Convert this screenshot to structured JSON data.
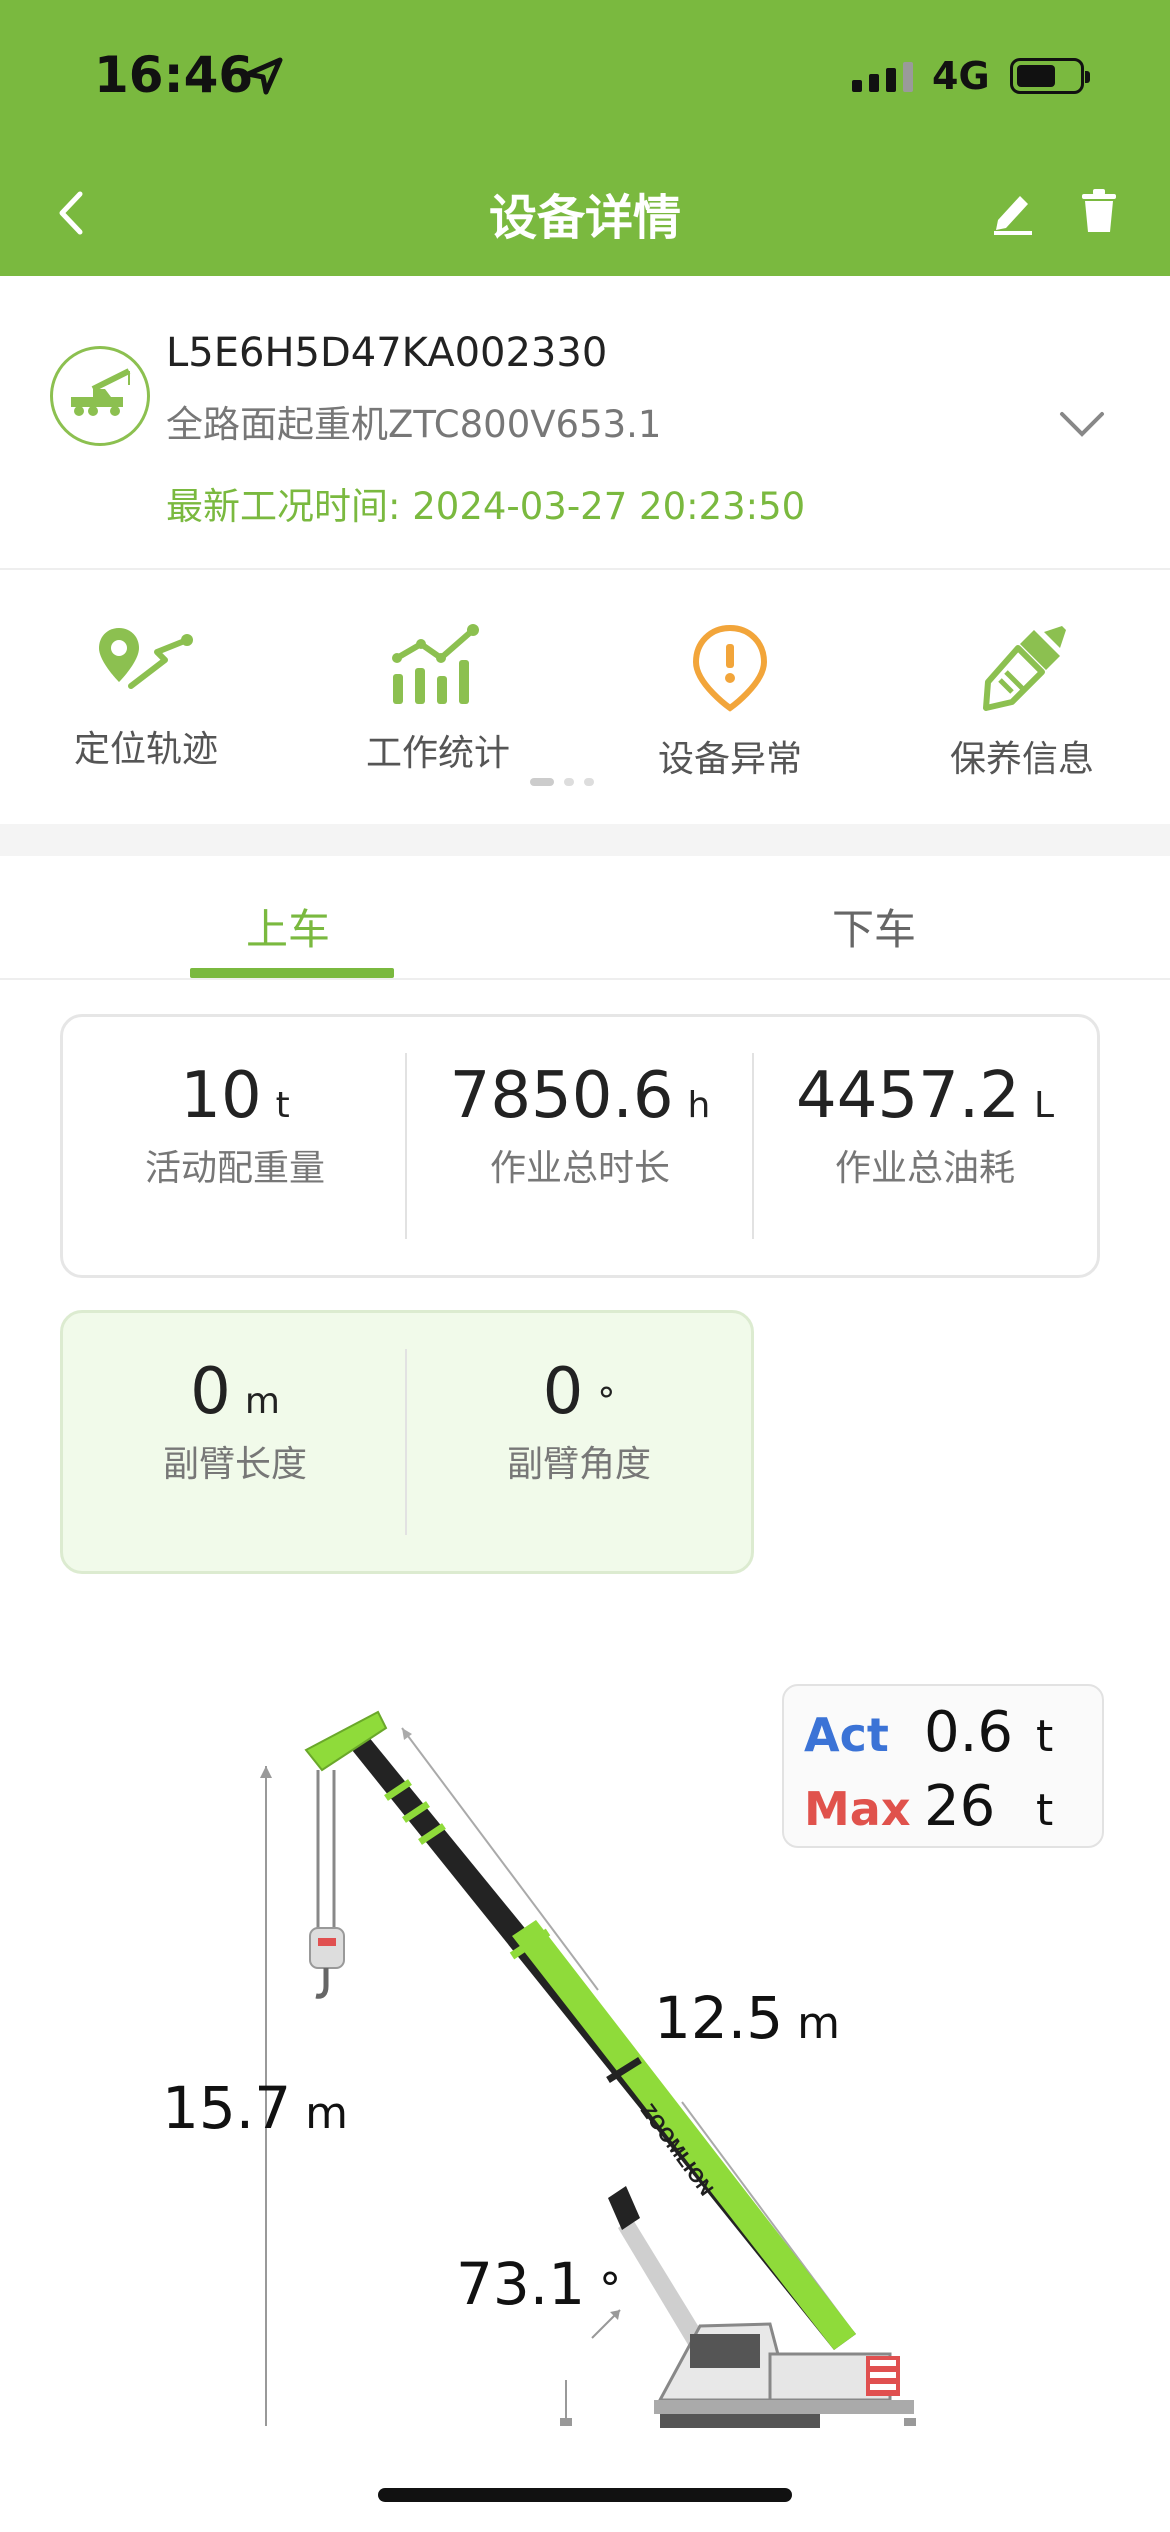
{
  "status_bar": {
    "time": "16:46",
    "network": "4G"
  },
  "nav": {
    "title": "设备详情"
  },
  "device": {
    "vin": "L5E6H5D47KA002330",
    "model": "全路面起重机ZTC800V653.1",
    "latest_label": "最新工况时间: ",
    "latest_time": "2024-03-27 20:23:50"
  },
  "shortcuts": [
    {
      "label": "定位轨迹",
      "icon": "location-track-icon"
    },
    {
      "label": "工作统计",
      "icon": "stats-chart-icon"
    },
    {
      "label": "设备异常",
      "icon": "alert-icon"
    },
    {
      "label": "保养信息",
      "icon": "brush-icon"
    }
  ],
  "tabs": [
    {
      "label": "上车",
      "active": true
    },
    {
      "label": "下车",
      "active": false
    }
  ],
  "stats": [
    {
      "value": "10",
      "unit": "t",
      "label": "活动配重量"
    },
    {
      "value": "7850.6",
      "unit": "h",
      "label": "作业总时长"
    },
    {
      "value": "4457.2",
      "unit": "L",
      "label": "作业总油耗"
    }
  ],
  "jib": [
    {
      "value": "0",
      "unit": "m",
      "label": "副臂长度"
    },
    {
      "value": "0",
      "unit": "°",
      "label": "副臂角度"
    }
  ],
  "load": {
    "act_label": "Act",
    "act_value": "0.6",
    "act_unit": "t",
    "max_label": "Max",
    "max_value": "26",
    "max_unit": "t"
  },
  "crane": {
    "boom_length": "12.5",
    "boom_length_unit": "m",
    "height": "15.7",
    "height_unit": "m",
    "angle": "73.1",
    "angle_unit": "°",
    "brand": "ZOOMLION"
  },
  "colors": {
    "brand": "#7ab93f",
    "act": "#3b73d6",
    "max": "#e0524c",
    "alert": "#f2a53a"
  }
}
